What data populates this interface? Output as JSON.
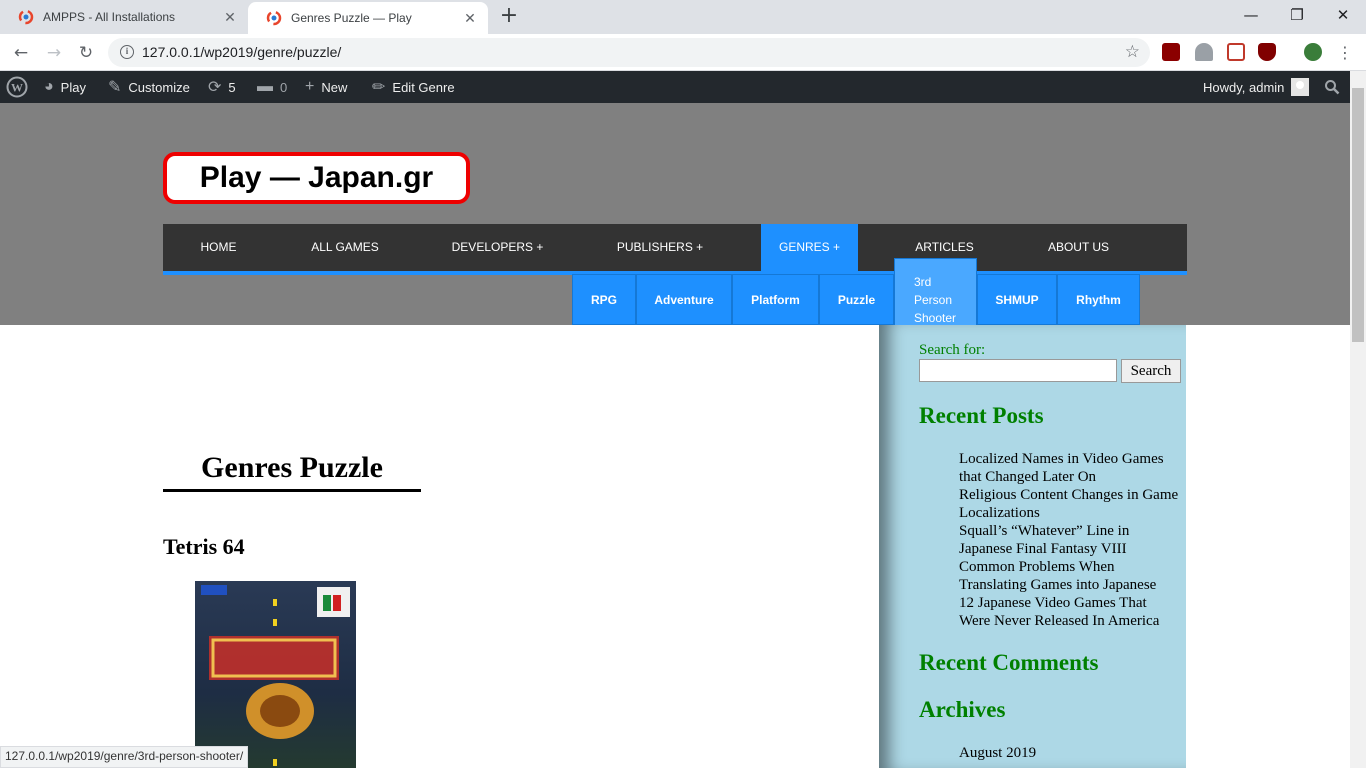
{
  "browser": {
    "tabs": [
      {
        "title": "AMPPS - All Installations",
        "active": false
      },
      {
        "title": "Genres Puzzle — Play",
        "active": true
      }
    ],
    "url": "127.0.0.1/wp2019/genre/puzzle/",
    "status_url": "127.0.0.1/wp2019/genre/3rd-person-shooter/"
  },
  "adminbar": {
    "site": "Play",
    "customize": "Customize",
    "updates_count": "5",
    "comments_count": "0",
    "new": "New",
    "edit": "Edit Genre",
    "howdy": "Howdy, admin"
  },
  "site": {
    "title": "Play — Japan.gr"
  },
  "nav": {
    "items": [
      "HOME",
      "ALL GAMES",
      "DEVELOPERS +",
      "PUBLISHERS +",
      "GENRES +",
      "ARTICLES",
      "ABOUT US"
    ],
    "submenu": [
      "RPG",
      "Adventure",
      "Platform",
      "Puzzle",
      "3rd Person Shooter",
      "SHMUP",
      "Rhythm"
    ]
  },
  "main": {
    "page_title": "Genres Puzzle",
    "post_title": "Tetris 64"
  },
  "sidebar": {
    "search_label": "Search for:",
    "search_button": "Search",
    "recent_posts_heading": "Recent Posts",
    "recent_posts": [
      "Localized Names in Video Games that Changed Later On",
      "Religious Content Changes in Game Localizations",
      "Squall’s “Whatever” Line in Japanese Final Fantasy VIII",
      "Common Problems When Translating Games into Japanese",
      "12 Japanese Video Games That Were Never Released In America"
    ],
    "recent_comments_heading": "Recent Comments",
    "archives_heading": "Archives",
    "archives": [
      "August 2019"
    ]
  },
  "colors": {
    "accent": "#1e90ff",
    "sidebar_bg": "#add8e6",
    "sidebar_heading": "#008000",
    "title_border": "#ee0000"
  }
}
